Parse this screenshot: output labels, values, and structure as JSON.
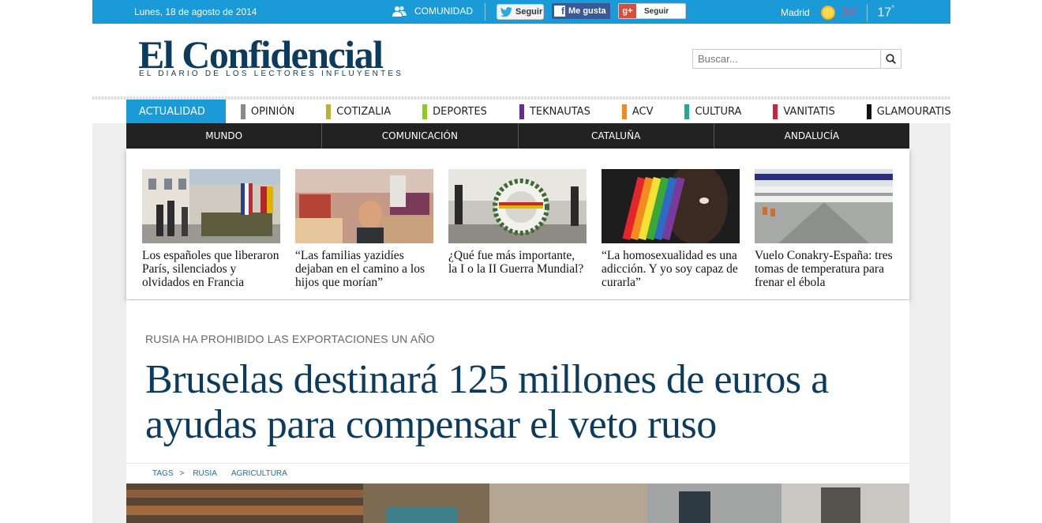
{
  "topbar": {
    "date": "Lunes, 18 de agosto de 2014",
    "community": "COMUNIDAD",
    "twitter": "Seguir",
    "facebook": "Me gusta",
    "google": "Seguir",
    "city": "Madrid",
    "temp_high": "34",
    "temp_low": "17",
    "deg": "°"
  },
  "header": {
    "logo": "El Confidencial",
    "tagline": "EL DIARIO DE LOS LECTORES INFLUYENTES",
    "search_placeholder": "Buscar..."
  },
  "nav": [
    {
      "label": "ACTUALIDAD",
      "color": "#1a9ad6"
    },
    {
      "label": "OPINIÓN",
      "color": "#8a8a8a"
    },
    {
      "label": "COTIZALIA",
      "color": "#b9b234"
    },
    {
      "label": "DEPORTES",
      "color": "#8fc81e"
    },
    {
      "label": "TEKNAUTAS",
      "color": "#6b2c91"
    },
    {
      "label": "ACV",
      "color": "#f08a24"
    },
    {
      "label": "CULTURA",
      "color": "#2aa595"
    },
    {
      "label": "VANITATIS",
      "color": "#d0223c"
    },
    {
      "label": "GLAMOURATIS",
      "color": "#111111"
    }
  ],
  "subnav": [
    "MUNDO",
    "COMUNICACIÓN",
    "CATALUÑA",
    "ANDALUCÍA"
  ],
  "stories": [
    "Los españoles que liberaron París, silenciados y olvidados en Francia",
    "“Las familias yazidíes dejaban en el camino a los hijos que morían”",
    "¿Qué fue más importante, la I o la II Guerra Mundial?",
    "“La homosexualidad es una adicción. Y yo soy capaz de curarla”",
    "Vuelo Conakry-España: tres tomas de temperatura para frenar el ébola"
  ],
  "article": {
    "kicker": "RUSIA HA PROHIBIDO LAS EXPORTACIONES UN AÑO",
    "headline": "Bruselas destinará 125 millones de euros a ayudas para compensar el veto ruso",
    "tags_label": "TAGS",
    "tags_sep": ">",
    "tags": [
      "RUSIA",
      "AGRICULTURA"
    ]
  }
}
